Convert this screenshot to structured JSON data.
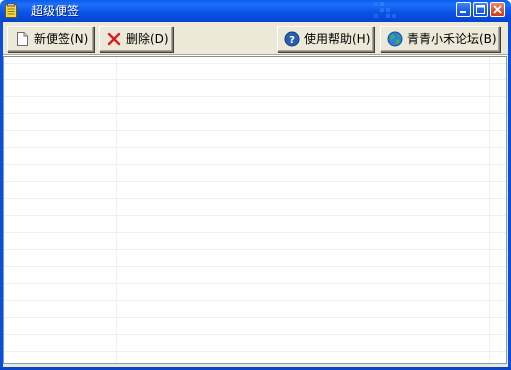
{
  "window": {
    "title": "超级便签"
  },
  "toolbar": {
    "new_label": "新便签(N)",
    "delete_label": "删除(D)",
    "help_label": "使用帮助(H)",
    "forum_label": "青青小禾论坛(B)"
  },
  "icons": {
    "app": "notepad-icon",
    "new": "blank-page-icon",
    "delete": "red-x-icon",
    "help": "question-circle-icon",
    "forum": "globe-icon"
  },
  "colors": {
    "titlebar": "#0a54e6",
    "face": "#ece9d8",
    "delete_x": "#d42020",
    "help_blue": "#2a5fb0",
    "grid": "#eef0f0"
  }
}
